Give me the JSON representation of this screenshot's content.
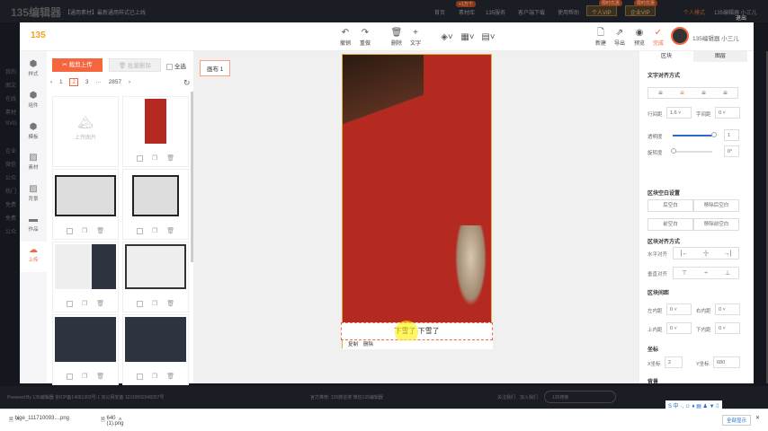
{
  "site": {
    "logo": "135编辑器",
    "notice": "【通用素材】最新通用样式已上线",
    "nav": [
      "首页",
      "素材库",
      "135服务",
      "客户端下载",
      "使用帮助"
    ],
    "nav_badge": "+1万个",
    "personal_vip": "个人VIP",
    "personal_vip_badge": "限时优惠",
    "enterprise_vip": "企业VIP",
    "enterprise_vip_badge": "限时优惠",
    "personal_mode": "个人模式",
    "user": "135编辑器 小三儿",
    "logout": "退出",
    "side_items": [
      "我的",
      "图文",
      "在线",
      "素材",
      "SVG",
      "企业",
      "微信",
      "公众",
      "热门",
      "免费",
      "免费",
      "公众"
    ]
  },
  "toolbar": {
    "logo": "135",
    "undo": "撤销",
    "redo": "重做",
    "delete": "删除",
    "text": "文字",
    "new": "新建",
    "export": "导出",
    "preview": "预览",
    "done": "完成",
    "username": "135编辑器",
    "nickname": "小三儿"
  },
  "rail": [
    {
      "icon": "cube-icon",
      "label": "样式"
    },
    {
      "icon": "cube-icon",
      "label": "组件"
    },
    {
      "icon": "cube-icon",
      "label": "模板"
    },
    {
      "icon": "material-icon",
      "label": "素材"
    },
    {
      "icon": "background-icon",
      "label": "背景"
    },
    {
      "icon": "briefcase-icon",
      "label": "作品"
    },
    {
      "icon": "upload-icon",
      "label": "上传"
    }
  ],
  "panel": {
    "crop_upload": "裁剪上传",
    "batch_delete": "批量删除",
    "select_all": "全选",
    "pages": [
      "1",
      "2",
      "3",
      "···",
      "2857"
    ],
    "current_page": "2",
    "upload_image": "上传图片"
  },
  "canvas": {
    "tag": "画布 1",
    "caption": "下雪了 下雪了",
    "copy": "复制",
    "delete": "删除"
  },
  "right": {
    "tabs": [
      "区块",
      "图层"
    ],
    "text_align": "文字对齐方式",
    "line_height_label": "行间距",
    "line_height": "1.6",
    "letter_spacing_label": "字间距",
    "letter_spacing": "0",
    "opacity_label": "透明度",
    "opacity": "1",
    "opacity_fraction": 1,
    "rotate_label": "旋转度",
    "rotate": "0°",
    "blank_title": "区块空白设置",
    "blank_buttons": [
      "后空白",
      "移除后空白",
      "前空白",
      "移除前空白"
    ],
    "block_align": "区块对齐方式",
    "h_align": "水平对齐",
    "v_align": "垂直对齐",
    "spacing": "区块间距",
    "left_pad_label": "左内距",
    "left_pad": "0",
    "right_pad_label": "右内距",
    "right_pad": "0",
    "top_pad_label": "上内距",
    "top_pad": "0",
    "bottom_pad_label": "下内距",
    "bottom_pad": "0",
    "coords": "坐标",
    "x_label": "X坐标",
    "x": "2",
    "y_label": "Y坐标",
    "y": "680",
    "background": "背景"
  },
  "footer": {
    "powered": "Powered By 135编辑器 京ICP备14061303号-1 京公网安备 11010502048357号",
    "partners": "官方推荐: 135微信搜 微信135编辑器",
    "links": [
      "关注我们",
      "加入我们"
    ],
    "search_placeholder": "135搜索"
  },
  "downloads": [
    {
      "name": "bige_111710093....png"
    },
    {
      "name": "640 (1).png"
    }
  ],
  "download_show_all": "全部显示"
}
